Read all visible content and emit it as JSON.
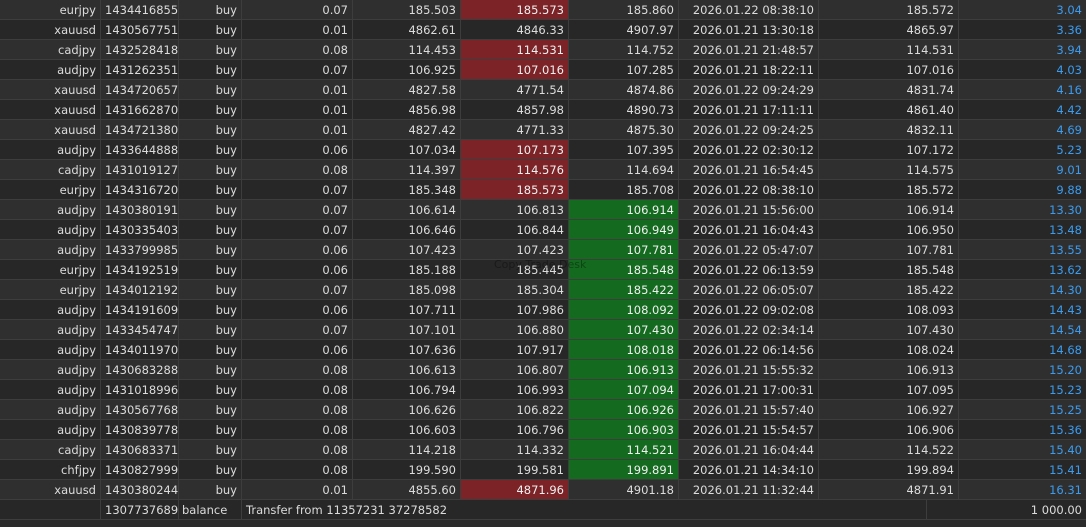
{
  "colors": {
    "row_odd": "#2f2f2f",
    "row_even": "#272727",
    "profit_text": "#3b9cf0",
    "loss_highlight": "#7b2326",
    "gain_highlight": "#146a1f"
  },
  "watermark": "Copy Trade Desk",
  "trades": [
    {
      "symbol": "eurjpy",
      "ticket": "1434416855",
      "type": "buy",
      "volume": "0.07",
      "open_price": "185.503",
      "sl": "185.573",
      "tp": "185.860",
      "time": "2026.01.22 08:38:10",
      "price": "185.572",
      "profit": "3.04",
      "sl_hl": "red",
      "tp_hl": ""
    },
    {
      "symbol": "xauusd",
      "ticket": "1430567751",
      "type": "buy",
      "volume": "0.01",
      "open_price": "4862.61",
      "sl": "4846.33",
      "tp": "4907.97",
      "time": "2026.01.21 13:30:18",
      "price": "4865.97",
      "profit": "3.36",
      "sl_hl": "",
      "tp_hl": ""
    },
    {
      "symbol": "cadjpy",
      "ticket": "1432528418",
      "type": "buy",
      "volume": "0.08",
      "open_price": "114.453",
      "sl": "114.531",
      "tp": "114.752",
      "time": "2026.01.21 21:48:57",
      "price": "114.531",
      "profit": "3.94",
      "sl_hl": "red",
      "tp_hl": ""
    },
    {
      "symbol": "audjpy",
      "ticket": "1431262351",
      "type": "buy",
      "volume": "0.07",
      "open_price": "106.925",
      "sl": "107.016",
      "tp": "107.285",
      "time": "2026.01.21 18:22:11",
      "price": "107.016",
      "profit": "4.03",
      "sl_hl": "red",
      "tp_hl": ""
    },
    {
      "symbol": "xauusd",
      "ticket": "1434720657",
      "type": "buy",
      "volume": "0.01",
      "open_price": "4827.58",
      "sl": "4771.54",
      "tp": "4874.86",
      "time": "2026.01.22 09:24:29",
      "price": "4831.74",
      "profit": "4.16",
      "sl_hl": "",
      "tp_hl": ""
    },
    {
      "symbol": "xauusd",
      "ticket": "1431662870",
      "type": "buy",
      "volume": "0.01",
      "open_price": "4856.98",
      "sl": "4857.98",
      "tp": "4890.73",
      "time": "2026.01.21 17:11:11",
      "price": "4861.40",
      "profit": "4.42",
      "sl_hl": "",
      "tp_hl": ""
    },
    {
      "symbol": "xauusd",
      "ticket": "1434721380",
      "type": "buy",
      "volume": "0.01",
      "open_price": "4827.42",
      "sl": "4771.33",
      "tp": "4875.30",
      "time": "2026.01.22 09:24:25",
      "price": "4832.11",
      "profit": "4.69",
      "sl_hl": "",
      "tp_hl": ""
    },
    {
      "symbol": "audjpy",
      "ticket": "1433644888",
      "type": "buy",
      "volume": "0.06",
      "open_price": "107.034",
      "sl": "107.173",
      "tp": "107.395",
      "time": "2026.01.22 02:30:12",
      "price": "107.172",
      "profit": "5.23",
      "sl_hl": "red",
      "tp_hl": ""
    },
    {
      "symbol": "cadjpy",
      "ticket": "1431019127",
      "type": "buy",
      "volume": "0.08",
      "open_price": "114.397",
      "sl": "114.576",
      "tp": "114.694",
      "time": "2026.01.21 16:54:45",
      "price": "114.575",
      "profit": "9.01",
      "sl_hl": "red",
      "tp_hl": ""
    },
    {
      "symbol": "eurjpy",
      "ticket": "1434316720",
      "type": "buy",
      "volume": "0.07",
      "open_price": "185.348",
      "sl": "185.573",
      "tp": "185.708",
      "time": "2026.01.22 08:38:10",
      "price": "185.572",
      "profit": "9.88",
      "sl_hl": "red",
      "tp_hl": ""
    },
    {
      "symbol": "audjpy",
      "ticket": "1430380191",
      "type": "buy",
      "volume": "0.07",
      "open_price": "106.614",
      "sl": "106.813",
      "tp": "106.914",
      "time": "2026.01.21 15:56:00",
      "price": "106.914",
      "profit": "13.30",
      "sl_hl": "",
      "tp_hl": "green"
    },
    {
      "symbol": "audjpy",
      "ticket": "1430335403",
      "type": "buy",
      "volume": "0.07",
      "open_price": "106.646",
      "sl": "106.844",
      "tp": "106.949",
      "time": "2026.01.21 16:04:43",
      "price": "106.950",
      "profit": "13.48",
      "sl_hl": "",
      "tp_hl": "green"
    },
    {
      "symbol": "audjpy",
      "ticket": "1433799985",
      "type": "buy",
      "volume": "0.06",
      "open_price": "107.423",
      "sl": "107.423",
      "tp": "107.781",
      "time": "2026.01.22 05:47:07",
      "price": "107.781",
      "profit": "13.55",
      "sl_hl": "",
      "tp_hl": "green"
    },
    {
      "symbol": "eurjpy",
      "ticket": "1434192519",
      "type": "buy",
      "volume": "0.06",
      "open_price": "185.188",
      "sl": "185.445",
      "tp": "185.548",
      "time": "2026.01.22 06:13:59",
      "price": "185.548",
      "profit": "13.62",
      "sl_hl": "",
      "tp_hl": "green"
    },
    {
      "symbol": "eurjpy",
      "ticket": "1434012192",
      "type": "buy",
      "volume": "0.07",
      "open_price": "185.098",
      "sl": "185.304",
      "tp": "185.422",
      "time": "2026.01.22 06:05:07",
      "price": "185.422",
      "profit": "14.30",
      "sl_hl": "",
      "tp_hl": "green"
    },
    {
      "symbol": "audjpy",
      "ticket": "1434191609",
      "type": "buy",
      "volume": "0.06",
      "open_price": "107.711",
      "sl": "107.986",
      "tp": "108.092",
      "time": "2026.01.22 09:02:08",
      "price": "108.093",
      "profit": "14.43",
      "sl_hl": "",
      "tp_hl": "green"
    },
    {
      "symbol": "audjpy",
      "ticket": "1433454747",
      "type": "buy",
      "volume": "0.07",
      "open_price": "107.101",
      "sl": "106.880",
      "tp": "107.430",
      "time": "2026.01.22 02:34:14",
      "price": "107.430",
      "profit": "14.54",
      "sl_hl": "",
      "tp_hl": "green"
    },
    {
      "symbol": "audjpy",
      "ticket": "1434011970",
      "type": "buy",
      "volume": "0.06",
      "open_price": "107.636",
      "sl": "107.917",
      "tp": "108.018",
      "time": "2026.01.22 06:14:56",
      "price": "108.024",
      "profit": "14.68",
      "sl_hl": "",
      "tp_hl": "green"
    },
    {
      "symbol": "audjpy",
      "ticket": "1430683288",
      "type": "buy",
      "volume": "0.08",
      "open_price": "106.613",
      "sl": "106.807",
      "tp": "106.913",
      "time": "2026.01.21 15:55:32",
      "price": "106.913",
      "profit": "15.20",
      "sl_hl": "",
      "tp_hl": "green"
    },
    {
      "symbol": "audjpy",
      "ticket": "1431018996",
      "type": "buy",
      "volume": "0.08",
      "open_price": "106.794",
      "sl": "106.993",
      "tp": "107.094",
      "time": "2026.01.21 17:00:31",
      "price": "107.095",
      "profit": "15.23",
      "sl_hl": "",
      "tp_hl": "green"
    },
    {
      "symbol": "audjpy",
      "ticket": "1430567768",
      "type": "buy",
      "volume": "0.08",
      "open_price": "106.626",
      "sl": "106.822",
      "tp": "106.926",
      "time": "2026.01.21 15:57:40",
      "price": "106.927",
      "profit": "15.25",
      "sl_hl": "",
      "tp_hl": "green"
    },
    {
      "symbol": "audjpy",
      "ticket": "1430839778",
      "type": "buy",
      "volume": "0.08",
      "open_price": "106.603",
      "sl": "106.796",
      "tp": "106.903",
      "time": "2026.01.21 15:54:57",
      "price": "106.906",
      "profit": "15.36",
      "sl_hl": "",
      "tp_hl": "green"
    },
    {
      "symbol": "cadjpy",
      "ticket": "1430683371",
      "type": "buy",
      "volume": "0.08",
      "open_price": "114.218",
      "sl": "114.332",
      "tp": "114.521",
      "time": "2026.01.21 16:04:44",
      "price": "114.522",
      "profit": "15.40",
      "sl_hl": "",
      "tp_hl": "green"
    },
    {
      "symbol": "chfjpy",
      "ticket": "1430827999",
      "type": "buy",
      "volume": "0.08",
      "open_price": "199.590",
      "sl": "199.581",
      "tp": "199.891",
      "time": "2026.01.21 14:34:10",
      "price": "199.894",
      "profit": "15.41",
      "sl_hl": "",
      "tp_hl": "green"
    },
    {
      "symbol": "xauusd",
      "ticket": "1430380244",
      "type": "buy",
      "volume": "0.01",
      "open_price": "4855.60",
      "sl": "4871.96",
      "tp": "4901.18",
      "time": "2026.01.21 11:32:44",
      "price": "4871.91",
      "profit": "16.31",
      "sl_hl": "red",
      "tp_hl": ""
    }
  ],
  "balance_row": {
    "ticket": "1307737689",
    "type": "balance",
    "comment": "Transfer from 11357231 37278582",
    "amount": "1 000.00"
  }
}
